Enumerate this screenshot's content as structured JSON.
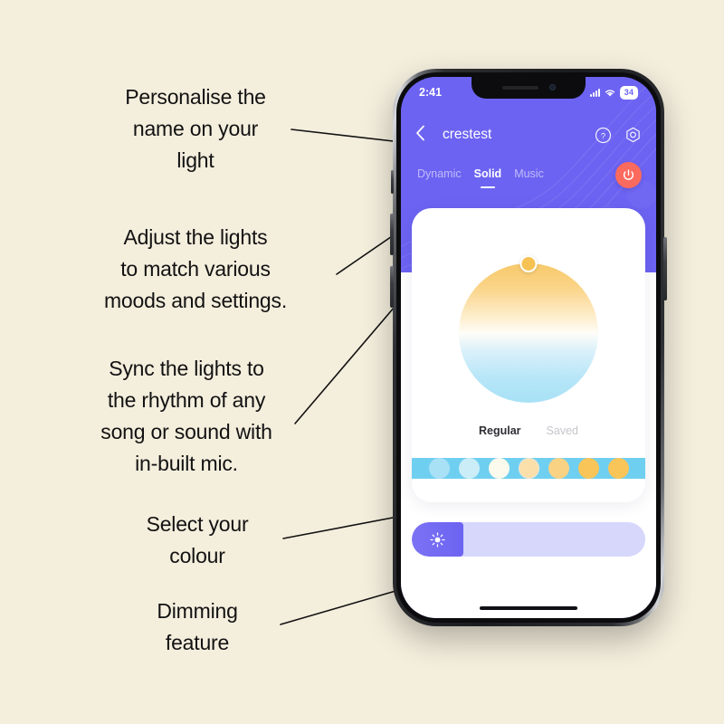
{
  "page": {
    "background_color": "#F4EEDD",
    "text_color": "#121212"
  },
  "annotations": [
    {
      "id": "name",
      "text": "Personalise the\nname on your\nlight"
    },
    {
      "id": "adjust",
      "text": "Adjust the lights\nto match various\nmoods and settings."
    },
    {
      "id": "music",
      "text": "Sync the lights to\nthe rhythm of any\nsong or sound with\nin-built mic."
    },
    {
      "id": "colour",
      "text": "Select your\ncolour"
    },
    {
      "id": "dim",
      "text": "Dimming\nfeature"
    }
  ],
  "phone": {
    "status_bar": {
      "time": "2:41",
      "battery_level": "34",
      "wifi_icon": "wifi-icon",
      "signal_icon": "cellular-signal-icon"
    },
    "nav": {
      "back_icon": "chevron-left-icon",
      "title": "crestest",
      "help_icon": "help-circle-icon",
      "settings_icon": "gear-icon"
    },
    "tabs": [
      {
        "label": "Dynamic",
        "active": false
      },
      {
        "label": "Solid",
        "active": true
      },
      {
        "label": "Music",
        "active": false
      }
    ],
    "power_button": {
      "icon": "power-icon",
      "color": "#FB6A5E"
    },
    "card": {
      "color_wheel": {
        "handle_icon": "color-handle",
        "handle_color": "#F6C254",
        "gradient_top": "#F7C96B",
        "gradient_mid": "#FFFDF8",
        "gradient_bottom": "#A8E1F6"
      },
      "segments": [
        {
          "label": "Regular",
          "active": true
        },
        {
          "label": "Saved",
          "active": false
        }
      ],
      "swatches": [
        {
          "color": "#6FCFF0",
          "selected": true
        },
        {
          "color": "#A8E0F6",
          "selected": false
        },
        {
          "color": "#CBEDF7",
          "selected": false
        },
        {
          "color": "#FCFAEC",
          "selected": false
        },
        {
          "color": "#FADFAA",
          "selected": false
        },
        {
          "color": "#FAD284",
          "selected": false
        },
        {
          "color": "#F9C558",
          "selected": false
        }
      ]
    },
    "dimmer": {
      "icon": "brightness-sun-icon",
      "fill_percent": "22",
      "track_color": "#D6D7FB",
      "fill_color": "#6C63F2"
    },
    "home_indicator": "home-indicator-bar",
    "accent_color": "#6C63F2"
  }
}
